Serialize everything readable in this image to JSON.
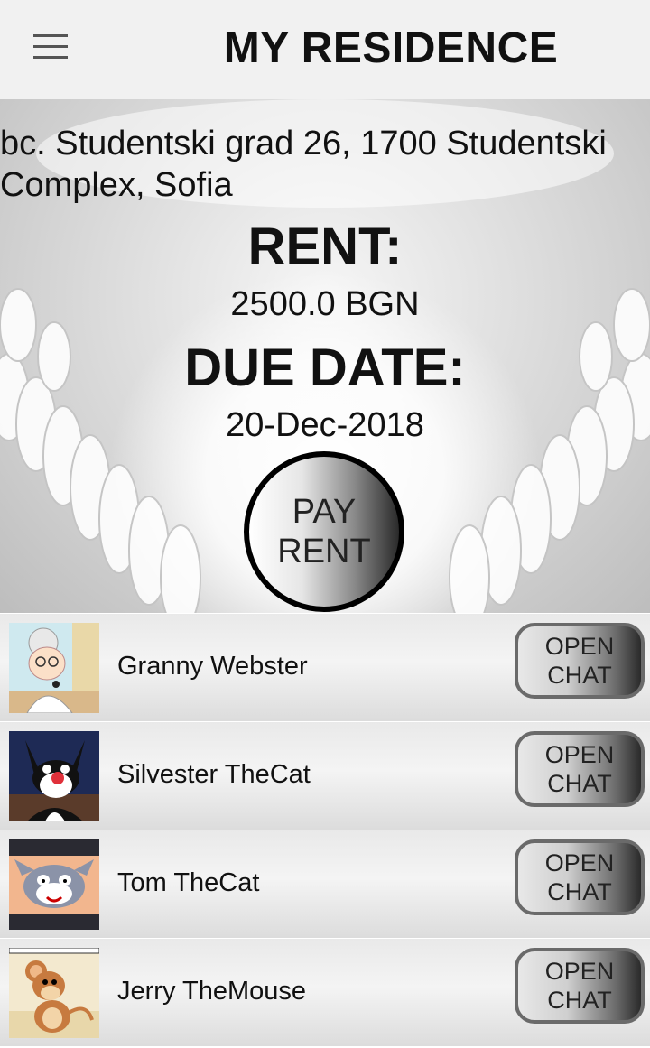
{
  "appbar": {
    "title": "MY RESIDENCE",
    "menu_icon": "hamburger-menu-icon"
  },
  "residence": {
    "address": "bc. Studentski grad 26, 1700 Studentski Complex, Sofia",
    "rent_label": "RENT:",
    "rent_value": "2500.0 BGN",
    "due_label": "DUE DATE:",
    "due_value": "20-Dec-2018",
    "pay_button": "PAY RENT"
  },
  "contacts": [
    {
      "name": "Granny Webster",
      "button": "OPEN CHAT",
      "avatar": "granny-avatar"
    },
    {
      "name": "Silvester TheCat",
      "button": "OPEN CHAT",
      "avatar": "sylvester-avatar"
    },
    {
      "name": "Tom TheCat",
      "button": "OPEN CHAT",
      "avatar": "tom-avatar"
    },
    {
      "name": "Jerry TheMouse",
      "button": "OPEN CHAT",
      "avatar": "jerry-avatar"
    }
  ]
}
